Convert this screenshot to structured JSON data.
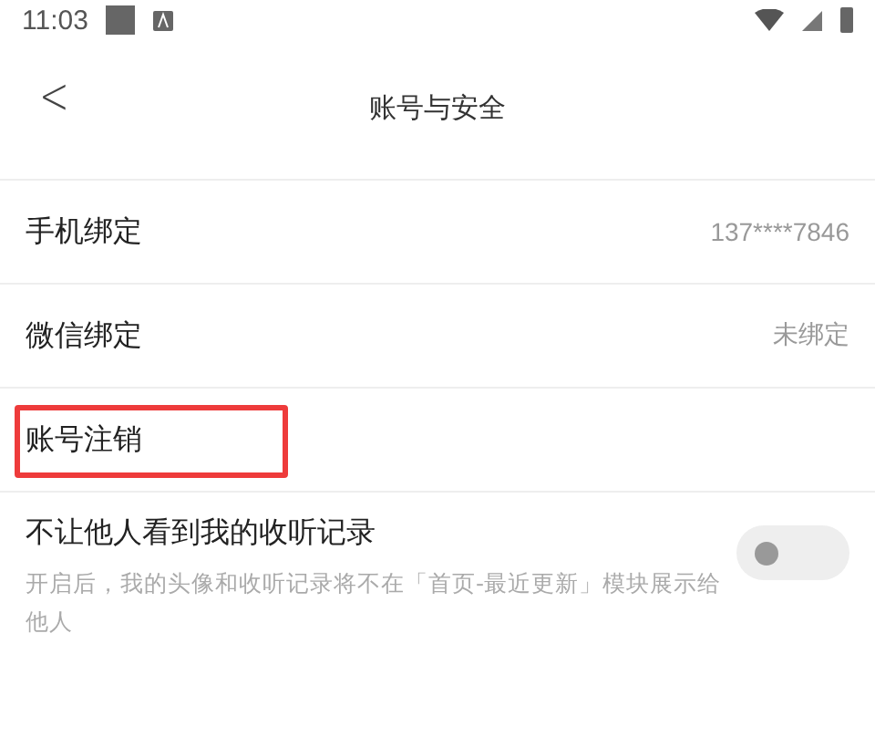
{
  "status_bar": {
    "time": "11:03"
  },
  "header": {
    "back": "<",
    "title": "账号与安全"
  },
  "rows": [
    {
      "label": "手机绑定",
      "value": "137****7846",
      "annotated": false
    },
    {
      "label": "微信绑定",
      "value": "未绑定",
      "annotated": false
    },
    {
      "label": "账号注销",
      "annotated": true
    }
  ],
  "privacy": {
    "label": "不让他人看到我的收听记录",
    "description": "开启后，我的头像和收听记录将不在「首页-最近更新」模块展示给他人",
    "on": false
  }
}
